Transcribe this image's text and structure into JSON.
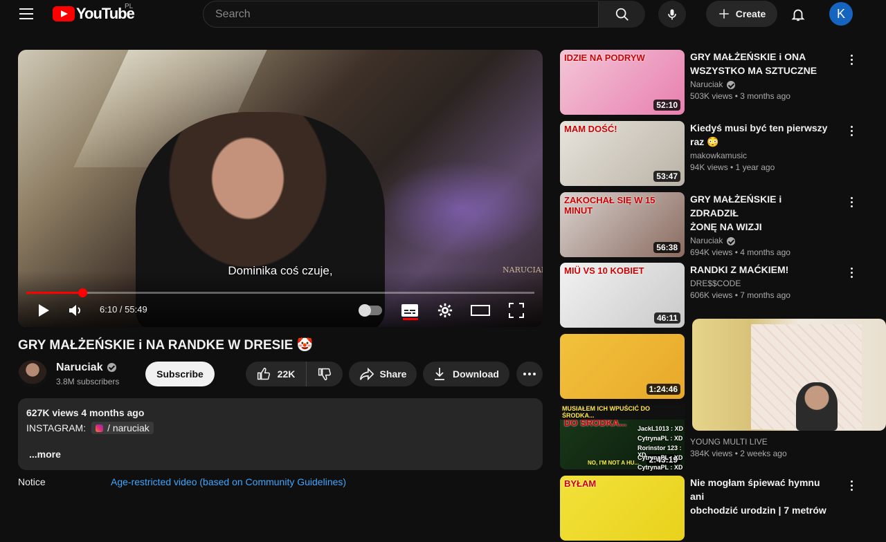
{
  "header": {
    "logo_text": "YouTube",
    "country_code": "PL",
    "search_placeholder": "Search",
    "create_label": "Create",
    "avatar_letter": "K"
  },
  "player": {
    "subtitle": "Dominika coś czuje,",
    "watermark": "NARUCIAK",
    "time_current": "6:10",
    "time_total": "55:49",
    "time_display": "6:10 / 55:49",
    "progress_fraction": 0.1105
  },
  "video": {
    "title": "GRY MAŁŻEŃSKIE i NA RANDKE W DRESIE 🤡",
    "channel_name": "Naruciak",
    "subscribers": "3.8M subscribers",
    "subscribe_label": "Subscribe",
    "like_count": "22K",
    "share_label": "Share",
    "download_label": "Download"
  },
  "description": {
    "stats": "627K views  4 months ago",
    "instagram_label": "INSTAGRAM:",
    "instagram_handle": "/ naruciak",
    "more_label": "...more",
    "notice_label": "Notice",
    "notice_value": "Age-restricted video (based on Community Guidelines)"
  },
  "sidebar": {
    "videos": [
      {
        "title_line1": "GRY MAŁŻEŃSKIE i ONA",
        "title_line2": "WSZYSTKO MA SZTUCZNE",
        "channel": "Naruciak",
        "verified": true,
        "meta": "503K views • 3 months ago",
        "duration": "52:10",
        "thumb_text": "IDZIE NA PODRYW",
        "thumb_colors": [
          "#f3c6d6",
          "#e87fb0"
        ]
      },
      {
        "title_line1": "Kiedyś musi być ten pierwszy",
        "title_line2": "raz 😳",
        "channel": "makowkamusic",
        "verified": false,
        "meta": "94K views • 1 year ago",
        "duration": "53:47",
        "thumb_text": "MAM DOŚĆ!",
        "thumb_colors": [
          "#e8e4dc",
          "#b9b2a6"
        ]
      },
      {
        "title_line1": "GRY MAŁŻEŃSKIE i ZDRADZIŁ",
        "title_line2": "ŻONĘ NA WIZJI",
        "channel": "Naruciak",
        "verified": true,
        "meta": "694K views • 4 months ago",
        "duration": "56:38",
        "thumb_text": "ZAKOCHAŁ SIĘ W 15 MINUT",
        "thumb_colors": [
          "#d9d2cf",
          "#8a6b5f"
        ]
      },
      {
        "title_line1": "RANDKI Z MAĆKIEM!",
        "title_line2": "",
        "channel": "DRE$$CODE",
        "verified": false,
        "meta": "606K views • 7 months ago",
        "duration": "46:11",
        "thumb_text": "MIÜ VS 10 KOBIET",
        "thumb_colors": [
          "#f2f2f2",
          "#c9c9c9"
        ]
      },
      {
        "title_line1": "",
        "title_line2": "",
        "channel": "",
        "verified": false,
        "meta": "",
        "duration": "1:24:46",
        "thumb_text": "",
        "thumb_colors": [
          "#f2c23c",
          "#e8a82a"
        ]
      },
      {
        "title_line1": "",
        "title_line2": "",
        "channel": "YOUNG MULTI LIVE",
        "verified": false,
        "meta": "384K views • 2 weeks ago",
        "duration": "2:43:19",
        "thumb_text": "MUSIAŁEM ICH WPUŚCIĆ DO ŚRODKA...",
        "thumb_colors": [
          "#1a3a1a",
          "#0b1a0b"
        ]
      },
      {
        "title_line1": "Nie mogłam śpiewać hymnu ani",
        "title_line2": "obchodzić urodzin | 7 metrów",
        "channel": "",
        "verified": false,
        "meta": "",
        "duration": "",
        "thumb_text": "BYŁAM",
        "thumb_colors": [
          "#f2e13a",
          "#e9d21c"
        ]
      }
    ],
    "chat_lines": [
      "JackL1013 : XD",
      "CytrynaPL : XD",
      "Rorinstor 123 : XD",
      "CytrynaPL : XD",
      "CytrynaPL : XD"
    ],
    "chat_banner": "NO, I'M NOT A HU..."
  },
  "colors": {
    "accent_red": "#ff0000",
    "link_blue": "#3ea6ff",
    "avatar_blue": "#1565c0"
  }
}
